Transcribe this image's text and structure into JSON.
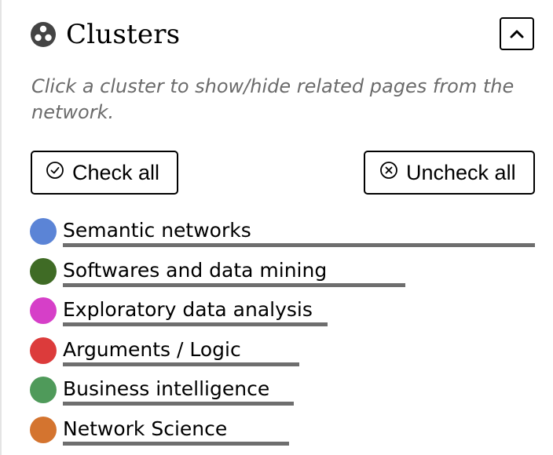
{
  "panel": {
    "title": "Clusters",
    "title_icon": "cluster-icon",
    "collapse_icon": "chevron-up-icon",
    "hint": "Click a cluster to show/hide related pages from the network."
  },
  "actions": {
    "check_all_label": "Check all",
    "check_all_icon": "check-circle-icon",
    "uncheck_all_label": "Uncheck all",
    "uncheck_all_icon": "x-circle-icon"
  },
  "clusters": [
    {
      "label": "Semantic networks",
      "color": "#5b84d6",
      "share": 1.0
    },
    {
      "label": "Softwares and data mining",
      "color": "#3f6b25",
      "share": 0.725
    },
    {
      "label": "Exploratory data analysis",
      "color": "#d63fc8",
      "share": 0.56
    },
    {
      "label": "Arguments / Logic",
      "color": "#dc3b3b",
      "share": 0.5
    },
    {
      "label": "Business intelligence",
      "color": "#4f9a5a",
      "share": 0.49
    },
    {
      "label": "Network Science",
      "color": "#d4742f",
      "share": 0.48
    }
  ]
}
